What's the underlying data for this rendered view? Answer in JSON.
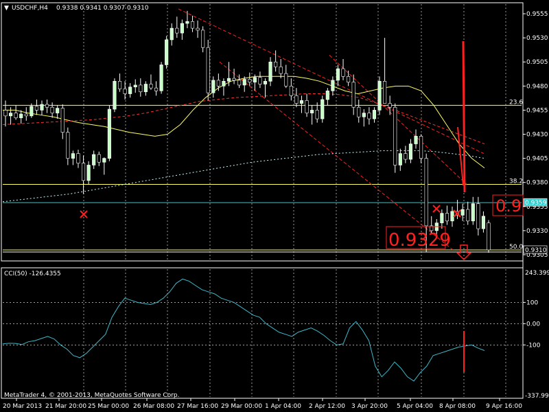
{
  "header": {
    "symbol": "USDCHF,H4",
    "ohlc": "0.9338 0.9341 0.9307 0.9310",
    "copyright": "MetaTrader 4, © 2001-2013, MetaQuotes Software Corp."
  },
  "indicator": {
    "label": "CCI(50) -126.4355",
    "max_label": "243.3995",
    "min_label": "-337.996",
    "levels": [
      "100",
      "0.00",
      "-100"
    ]
  },
  "price_axis": {
    "ticks": [
      "0.9555",
      "0.9530",
      "0.9505",
      "0.9480",
      "0.9455",
      "0.9430",
      "0.9405",
      "0.9380",
      "0.9355",
      "0.9330",
      "0.9305"
    ],
    "current_price_badge": "0.9310",
    "line_price_badge": "0.9359"
  },
  "time_axis": {
    "labels": [
      "20 Mar 2013",
      "21 Mar 20:00",
      "25 Mar 00:00",
      "26 Mar 08:00",
      "27 Mar 16:00",
      "29 Mar 00:00",
      "1 Apr 04:00",
      "2 Apr 12:00",
      "3 Apr 20:00",
      "5 Apr 04:00",
      "8 Apr 08:00",
      "9 Apr 16:00"
    ]
  },
  "fib_labels": [
    "23.6",
    "38.2",
    "50.0"
  ],
  "annotations": {
    "price_text_1": "0.9329",
    "price_text_2": "0.9"
  },
  "colors": {
    "background": "#000000",
    "bull_candle": "#c8ffc8",
    "bear_candle": "#ffffff",
    "grid": "#ffffff",
    "fib_line": "#ffff66",
    "horizontal_line": "#33cccc",
    "ma_fast": "#ffff66",
    "ma_slow": "#ff3030",
    "ma_long": "#ccffff",
    "cci_line": "#3fb8c8",
    "annotation": "#ff2020",
    "channel": "#ff2020"
  },
  "chart_data": {
    "type": "candlestick",
    "symbol": "USDCHF",
    "timeframe": "H4",
    "ylim": [
      0.93,
      0.9565
    ],
    "candles": [
      [
        0.9455,
        0.9465,
        0.9438,
        0.9449
      ],
      [
        0.9449,
        0.9458,
        0.944,
        0.9452
      ],
      [
        0.9452,
        0.946,
        0.9445,
        0.9447
      ],
      [
        0.9447,
        0.9455,
        0.9441,
        0.9451
      ],
      [
        0.9451,
        0.9458,
        0.9444,
        0.9449
      ],
      [
        0.9449,
        0.9462,
        0.9447,
        0.9459
      ],
      [
        0.9459,
        0.9466,
        0.945,
        0.9455
      ],
      [
        0.9455,
        0.9465,
        0.945,
        0.9461
      ],
      [
        0.9461,
        0.9466,
        0.9452,
        0.9458
      ],
      [
        0.9458,
        0.9463,
        0.9447,
        0.9452
      ],
      [
        0.9452,
        0.946,
        0.9446,
        0.9457
      ],
      [
        0.9457,
        0.9461,
        0.9425,
        0.9432
      ],
      [
        0.9432,
        0.9437,
        0.9398,
        0.9405
      ],
      [
        0.9405,
        0.9413,
        0.9398,
        0.941
      ],
      [
        0.941,
        0.9414,
        0.9395,
        0.94
      ],
      [
        0.94,
        0.9408,
        0.9368,
        0.9382
      ],
      [
        0.9382,
        0.9402,
        0.9378,
        0.9398
      ],
      [
        0.9398,
        0.9413,
        0.9394,
        0.9409
      ],
      [
        0.9409,
        0.9412,
        0.9397,
        0.9401
      ],
      [
        0.9401,
        0.9406,
        0.9388,
        0.9405
      ],
      [
        0.9405,
        0.946,
        0.9402,
        0.9456
      ],
      [
        0.9456,
        0.9488,
        0.9453,
        0.9485
      ],
      [
        0.9485,
        0.9493,
        0.9474,
        0.9477
      ],
      [
        0.9477,
        0.9485,
        0.9466,
        0.9472
      ],
      [
        0.9472,
        0.9483,
        0.9468,
        0.9479
      ],
      [
        0.9479,
        0.9487,
        0.9473,
        0.9481
      ],
      [
        0.9481,
        0.9488,
        0.9469,
        0.9474
      ],
      [
        0.9474,
        0.9485,
        0.947,
        0.9482
      ],
      [
        0.9482,
        0.9492,
        0.9476,
        0.9478
      ],
      [
        0.9478,
        0.9485,
        0.947,
        0.9475
      ],
      [
        0.9475,
        0.9505,
        0.9472,
        0.9502
      ],
      [
        0.9502,
        0.9532,
        0.9498,
        0.9528
      ],
      [
        0.9528,
        0.9545,
        0.9522,
        0.954
      ],
      [
        0.954,
        0.9552,
        0.953,
        0.9535
      ],
      [
        0.9535,
        0.9549,
        0.9528,
        0.9545
      ],
      [
        0.9545,
        0.9558,
        0.954,
        0.9547
      ],
      [
        0.9547,
        0.9553,
        0.9536,
        0.954
      ],
      [
        0.954,
        0.9548,
        0.953,
        0.9538
      ],
      [
        0.9538,
        0.9542,
        0.9515,
        0.952
      ],
      [
        0.952,
        0.9528,
        0.9465,
        0.9473
      ],
      [
        0.9473,
        0.949,
        0.9468,
        0.9486
      ],
      [
        0.9486,
        0.9493,
        0.9475,
        0.948
      ],
      [
        0.948,
        0.9488,
        0.947,
        0.9485
      ],
      [
        0.9485,
        0.9505,
        0.948,
        0.9488
      ],
      [
        0.9488,
        0.9498,
        0.9482,
        0.9486
      ],
      [
        0.9486,
        0.9492,
        0.9478,
        0.9481
      ],
      [
        0.9481,
        0.949,
        0.9474,
        0.9487
      ],
      [
        0.9487,
        0.9494,
        0.948,
        0.9484
      ],
      [
        0.9484,
        0.9492,
        0.9475,
        0.9489
      ],
      [
        0.9489,
        0.9495,
        0.9478,
        0.9482
      ],
      [
        0.9482,
        0.9488,
        0.9468,
        0.9485
      ],
      [
        0.9485,
        0.951,
        0.948,
        0.9505
      ],
      [
        0.9505,
        0.9517,
        0.9495,
        0.95
      ],
      [
        0.95,
        0.9508,
        0.9488,
        0.9493
      ],
      [
        0.9493,
        0.9502,
        0.9478,
        0.948
      ],
      [
        0.948,
        0.9488,
        0.9465,
        0.947
      ],
      [
        0.947,
        0.9478,
        0.9458,
        0.9462
      ],
      [
        0.9462,
        0.947,
        0.9452,
        0.9465
      ],
      [
        0.9465,
        0.9472,
        0.9448,
        0.9452
      ],
      [
        0.9452,
        0.946,
        0.944,
        0.9455
      ],
      [
        0.9455,
        0.9463,
        0.9442,
        0.9446
      ],
      [
        0.9446,
        0.947,
        0.9442,
        0.9466
      ],
      [
        0.9466,
        0.9478,
        0.946,
        0.9475
      ],
      [
        0.9475,
        0.949,
        0.947,
        0.9486
      ],
      [
        0.9486,
        0.9502,
        0.948,
        0.9498
      ],
      [
        0.9498,
        0.9508,
        0.9486,
        0.949
      ],
      [
        0.949,
        0.9496,
        0.948,
        0.9484
      ],
      [
        0.9484,
        0.9492,
        0.945,
        0.9458
      ],
      [
        0.9458,
        0.9466,
        0.9442,
        0.9448
      ],
      [
        0.9448,
        0.9456,
        0.9438,
        0.9452
      ],
      [
        0.9452,
        0.9458,
        0.944,
        0.9446
      ],
      [
        0.9446,
        0.9458,
        0.9442,
        0.9455
      ],
      [
        0.9455,
        0.949,
        0.945,
        0.9485
      ],
      [
        0.9485,
        0.953,
        0.948,
        0.9462
      ],
      [
        0.9462,
        0.947,
        0.945,
        0.9458
      ],
      [
        0.9458,
        0.9462,
        0.939,
        0.9398
      ],
      [
        0.9398,
        0.9415,
        0.9392,
        0.941
      ],
      [
        0.941,
        0.9418,
        0.94,
        0.9404
      ],
      [
        0.9404,
        0.9425,
        0.94,
        0.942
      ],
      [
        0.942,
        0.9435,
        0.9415,
        0.9428
      ],
      [
        0.9428,
        0.943,
        0.94,
        0.9405
      ],
      [
        0.9405,
        0.941,
        0.9308,
        0.9335
      ],
      [
        0.9335,
        0.9345,
        0.9326,
        0.933
      ],
      [
        0.933,
        0.9342,
        0.9324,
        0.9338
      ],
      [
        0.9338,
        0.9352,
        0.9332,
        0.9348
      ],
      [
        0.9348,
        0.9356,
        0.9336,
        0.934
      ],
      [
        0.934,
        0.9355,
        0.9334,
        0.935
      ],
      [
        0.935,
        0.9362,
        0.9342,
        0.9346
      ],
      [
        0.9346,
        0.9358,
        0.934,
        0.9352
      ],
      [
        0.9352,
        0.936,
        0.9336,
        0.934
      ],
      [
        0.934,
        0.9365,
        0.9336,
        0.9358
      ],
      [
        0.9358,
        0.9365,
        0.9325,
        0.9332
      ],
      [
        0.9332,
        0.935,
        0.9328,
        0.9345
      ],
      [
        0.9338,
        0.9341,
        0.9307,
        0.931
      ]
    ],
    "ma_fast": [
      0.9455,
      0.9455,
      0.9452,
      0.945,
      0.9448,
      0.9445,
      0.9442,
      0.944,
      0.9438,
      0.9435,
      0.9432,
      0.943,
      0.9428,
      0.943,
      0.944,
      0.9455,
      0.9468,
      0.9478,
      0.9485,
      0.9488,
      0.949,
      0.949,
      0.949,
      0.949,
      0.9488,
      0.9485,
      0.948,
      0.9475,
      0.9472,
      0.9475,
      0.9478,
      0.948,
      0.948,
      0.9475,
      0.946,
      0.944,
      0.942,
      0.9405,
      0.9395
    ],
    "ma_slow": [
      0.944,
      0.9441,
      0.9442,
      0.9443,
      0.9444,
      0.9445,
      0.9447,
      0.9449,
      0.9452,
      0.9456,
      0.946,
      0.9464,
      0.9466,
      0.9468,
      0.9469,
      0.947,
      0.9471,
      0.9472,
      0.9472,
      0.9471,
      0.9468,
      0.9462,
      0.9455,
      0.9448,
      0.9441,
      0.9434,
      0.9427,
      0.942
    ],
    "ma_long": [
      0.936,
      0.9362,
      0.9364,
      0.9366,
      0.9368,
      0.9371,
      0.9374,
      0.9377,
      0.938,
      0.9383,
      0.9386,
      0.9389,
      0.9392,
      0.9395,
      0.9398,
      0.9401,
      0.9403,
      0.9405,
      0.9407,
      0.9409,
      0.941,
      0.9411,
      0.9412,
      0.9413,
      0.9413,
      0.9413,
      0.9412,
      0.941,
      0.9408,
      0.9405
    ],
    "horizontal_lines": {
      "fib_23_6": 0.946,
      "fib_38_2": 0.9378,
      "fib_50_0": 0.931,
      "cyan_line": 0.9359
    },
    "cci": {
      "ylim": [
        -337.996,
        243.3995
      ],
      "levels": [
        100,
        0,
        -100
      ],
      "values": [
        -95,
        -92,
        -93,
        -98,
        -85,
        -80,
        -70,
        -60,
        -72,
        -100,
        -120,
        -150,
        -160,
        -140,
        -110,
        -80,
        -50,
        30,
        80,
        120,
        110,
        100,
        95,
        90,
        100,
        120,
        150,
        190,
        210,
        200,
        180,
        160,
        150,
        140,
        120,
        110,
        100,
        80,
        60,
        40,
        30,
        0,
        -20,
        -40,
        -50,
        -60,
        -40,
        -30,
        -20,
        -35,
        -55,
        -80,
        -100,
        -95,
        -20,
        10,
        -30,
        -80,
        -200,
        -250,
        -220,
        -180,
        -210,
        -250,
        -270,
        -230,
        -200,
        -150,
        -140,
        -130,
        -120,
        -110,
        -105,
        -100,
        -115,
        -126.4355
      ]
    }
  }
}
